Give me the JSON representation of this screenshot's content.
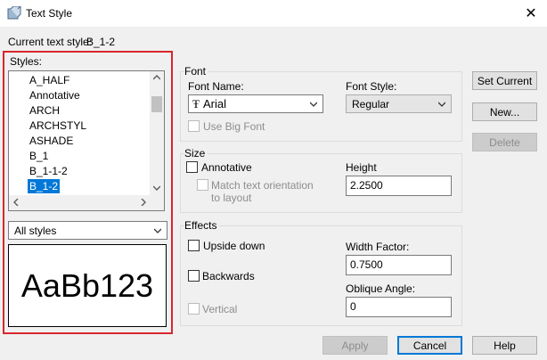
{
  "window": {
    "title": "Text Style",
    "close_glyph": "✕"
  },
  "current_style": {
    "label": "Current text style:",
    "value": "B_1-2"
  },
  "styles": {
    "label": "Styles:",
    "items": [
      "A_HALF",
      "Annotative",
      "ARCH",
      "ARCHSTYL",
      "ASHADE",
      "B_1",
      "B_1-1-2",
      "B_1-2"
    ],
    "selected": "B_1-2",
    "filter_value": "All styles",
    "preview_text": "AaBb123"
  },
  "font": {
    "group_label": "Font",
    "name_label": "Font Name:",
    "name_value": "Arial",
    "name_icon": "truetype-icon",
    "style_label": "Font Style:",
    "style_value": "Regular",
    "use_big_font_label": "Use Big Font"
  },
  "size": {
    "group_label": "Size",
    "annotative_label": "Annotative",
    "match_orientation_label_1": "Match text orientation",
    "match_orientation_label_2": "to layout",
    "height_label": "Height",
    "height_value": "2.2500"
  },
  "effects": {
    "group_label": "Effects",
    "upside_down_label": "Upside down",
    "backwards_label": "Backwards",
    "vertical_label": "Vertical",
    "width_factor_label": "Width Factor:",
    "width_factor_value": "0.7500",
    "oblique_label": "Oblique Angle:",
    "oblique_value": "0"
  },
  "buttons": {
    "set_current": "Set Current",
    "new": "New...",
    "delete": "Delete",
    "apply": "Apply",
    "cancel": "Cancel",
    "help": "Help"
  },
  "colors": {
    "selection": "#0078d7",
    "highlight_box": "#d9262c"
  }
}
